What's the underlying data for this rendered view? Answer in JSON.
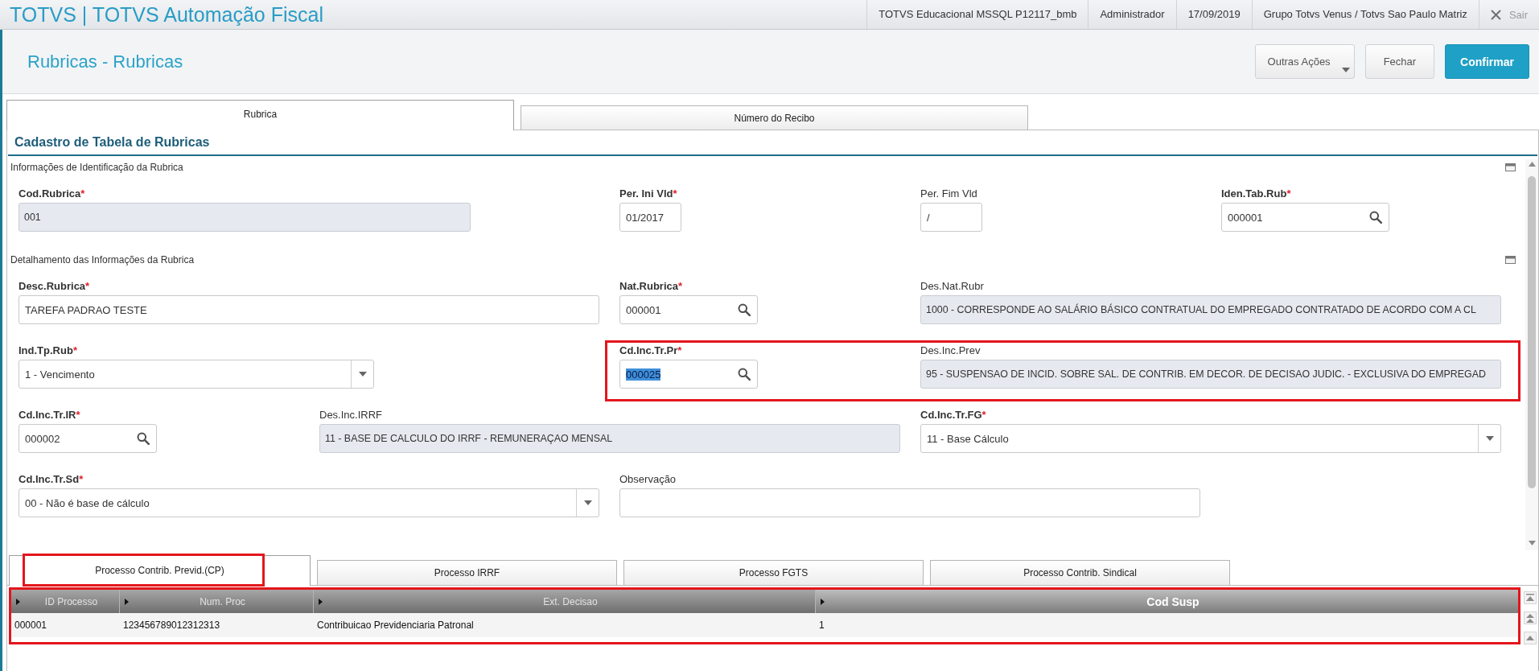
{
  "topbar": {
    "title": "TOTVS | TOTVS Automação Fiscal",
    "info": [
      "TOTVS Educacional MSSQL P12117_bmb",
      "Administrador",
      "17/09/2019",
      "Grupo Totvs Venus / Totvs Sao Paulo Matriz"
    ],
    "logout": "Sair"
  },
  "header": {
    "title": "Rubricas - Rubricas",
    "buttons": [
      {
        "label": "Outras Ações",
        "kind": "menu"
      },
      {
        "label": "Fechar",
        "kind": "default"
      },
      {
        "label": "Confirmar",
        "kind": "primary"
      }
    ]
  },
  "tabs": [
    {
      "label": "Rubrica",
      "selected": true
    },
    {
      "label": "Número do Recibo",
      "selected": false
    }
  ],
  "form": {
    "title": "Cadastro de Tabela de Rubricas",
    "sections": [
      {
        "title": "Informações de Identificação da Rubrica",
        "rows": [
          {
            "fields": [
              {
                "label": "Cod.Rubrica",
                "required_mark": "*",
                "kind": "readonly",
                "value": "001",
                "value_selected": false,
                "highlighted": false
              },
              {
                "label": "Per. Ini Vld",
                "required_mark": "*",
                "kind": "text",
                "value": "01/2017",
                "value_selected": false,
                "highlighted": false
              },
              {
                "label": "Per. Fim Vld",
                "kind": "text",
                "value": "/",
                "value_selected": false,
                "highlighted": false
              },
              {
                "label": "Iden.Tab.Rub",
                "required_mark": "*",
                "kind": "lookup",
                "value": "000001",
                "value_selected": false,
                "highlighted": false
              }
            ]
          }
        ]
      },
      {
        "title": "Detalhamento das Informações da Rubrica",
        "rows": [
          {
            "fields": [
              {
                "label": "Desc.Rubrica",
                "required_mark": "*",
                "kind": "text",
                "value": "TAREFA PADRAO TESTE",
                "value_selected": false,
                "highlighted": false
              },
              {
                "label": "Nat.Rubrica",
                "required_mark": "*",
                "kind": "lookup",
                "value": "000001",
                "value_selected": false,
                "highlighted": false
              },
              {
                "label": "Des.Nat.Rubr",
                "kind": "readonly",
                "value": "1000 - CORRESPONDE AO SALÁRIO BÁSICO CONTRATUAL DO EMPREGADO CONTRATADO DE ACORDO COM A CL",
                "value_selected": false,
                "highlighted": false
              }
            ]
          },
          {
            "fields": [
              {
                "label": "Ind.Tp.Rub",
                "required_mark": "*",
                "kind": "select",
                "value": "1 - Vencimento",
                "value_selected": false,
                "highlighted": false
              },
              {
                "label": "Cd.Inc.Tr.Pr",
                "required_mark": "*",
                "kind": "lookup",
                "value": "000025",
                "value_selected": true,
                "highlighted": true
              },
              {
                "label": "Des.Inc.Prev",
                "kind": "readonly",
                "value": "95 - SUSPENSAO DE INCID. SOBRE SAL. DE CONTRIB. EM DECOR. DE DECISAO JUDIC. - EXCLUSIVA DO EMPREGAD",
                "value_selected": false,
                "highlighted": true
              }
            ]
          },
          {
            "fields": [
              {
                "label": "Cd.Inc.Tr.IR",
                "required_mark": "*",
                "kind": "lookup",
                "value": "000002",
                "value_selected": false,
                "highlighted": false
              },
              {
                "label": "Des.Inc.IRRF",
                "kind": "readonly",
                "value": "11 - BASE DE CALCULO DO IRRF - REMUNERAÇAO MENSAL",
                "value_selected": false,
                "highlighted": false
              },
              {
                "label": "Cd.Inc.Tr.FG",
                "required_mark": "*",
                "kind": "select",
                "value": "11 - Base Cálculo",
                "value_selected": false,
                "highlighted": false
              }
            ]
          },
          {
            "fields": [
              {
                "label": "Cd.Inc.Tr.Sd",
                "required_mark": "*",
                "kind": "select",
                "value": "00 - Não é base de cálculo",
                "value_selected": false,
                "highlighted": false
              },
              {
                "label": "Observação",
                "kind": "text",
                "highlighted": false
              }
            ]
          }
        ]
      }
    ]
  },
  "detail_tabs": [
    {
      "label": "Processo Contrib. Previd.(CP)",
      "selected": true,
      "highlighted": true
    },
    {
      "label": "Processo IRRF",
      "selected": false,
      "highlighted": false
    },
    {
      "label": "Processo FGTS",
      "selected": false,
      "highlighted": false
    },
    {
      "label": "Processo Contrib. Sindical",
      "selected": false,
      "highlighted": false
    }
  ],
  "grid": {
    "highlighted": true,
    "columns": [
      {
        "label": "ID Processo",
        "selected": false
      },
      {
        "label": "Num. Proc",
        "selected": false
      },
      {
        "label": "Ext. Decisao",
        "selected": false
      },
      {
        "label": "Cod Susp",
        "selected": true
      }
    ],
    "rows": [
      [
        "000001",
        "123456789012312313",
        "Contribuicao Previdenciaria Patronal",
        "1"
      ]
    ]
  }
}
